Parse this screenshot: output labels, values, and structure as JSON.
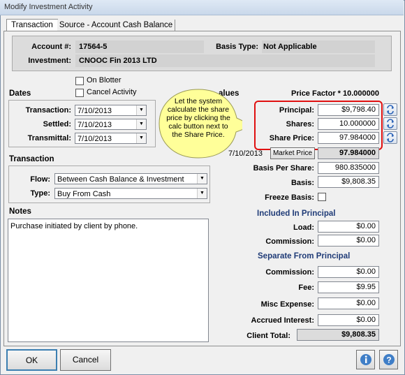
{
  "window": {
    "title": "Modify Investment Activity"
  },
  "tabs": [
    {
      "label": "Transaction"
    },
    {
      "label": "Source - Account Cash Balance"
    }
  ],
  "header": {
    "account_label": "Account #:",
    "account_value": "17564-5",
    "basis_type_label": "Basis Type:",
    "basis_type_value": "Not Applicable",
    "investment_label": "Investment:",
    "investment_value": "CNOOC Fin 2013 LTD"
  },
  "checkboxes": {
    "on_blotter": "On Blotter",
    "cancel_activity": "Cancel Activity"
  },
  "dates": {
    "section": "Dates",
    "transaction_label": "Transaction:",
    "transaction_value": "7/10/2013",
    "settled_label": "Settled:",
    "settled_value": "7/10/2013",
    "transmittal_label": "Transmittal:",
    "transmittal_value": "7/10/2013"
  },
  "transaction": {
    "section": "Transaction",
    "flow_label": "Flow:",
    "flow_value": "Between Cash Balance & Investment",
    "type_label": "Type:",
    "type_value": "Buy From Cash"
  },
  "notes": {
    "section": "Notes",
    "text": "Purchase initiated by client by phone."
  },
  "values": {
    "section_partial": "alues",
    "price_factor": "Price Factor * 10.000000",
    "principal_label": "Principal:",
    "principal_value": "$9,798.40",
    "shares_label": "Shares:",
    "shares_value": "10.000000",
    "share_price_label": "Share Price:",
    "share_price_value": "97.984000",
    "market_date": "7/10/2013",
    "market_price_button": "Market Price",
    "market_price_value": "97.984000",
    "basis_per_share_label": "Basis Per Share:",
    "basis_per_share_value": "980.835000",
    "basis_label": "Basis:",
    "basis_value": "$9,808.35",
    "freeze_basis_label": "Freeze Basis:",
    "included_heading": "Included In Principal",
    "load_label": "Load:",
    "load_value": "$0.00",
    "commission_label": "Commission:",
    "commission_value": "$0.00",
    "separate_heading": "Separate From Principal",
    "sep_commission_label": "Commission:",
    "sep_commission_value": "$0.00",
    "fee_label": "Fee:",
    "fee_value": "$9.95",
    "misc_label": "Misc Expense:",
    "misc_value": "$0.00",
    "accrued_label": "Accrued Interest:",
    "accrued_value": "$0.00",
    "client_total_label": "Client Total:",
    "client_total_value": "$9,808.35"
  },
  "callout": {
    "text": "Let the system calculate the share price by clicking the calc button next to the Share Price."
  },
  "buttons": {
    "ok": "OK",
    "cancel": "Cancel"
  },
  "colors": {
    "highlight": "#e01010",
    "callout_fill": "#ffff99",
    "heading_blue": "#1f3b77"
  }
}
